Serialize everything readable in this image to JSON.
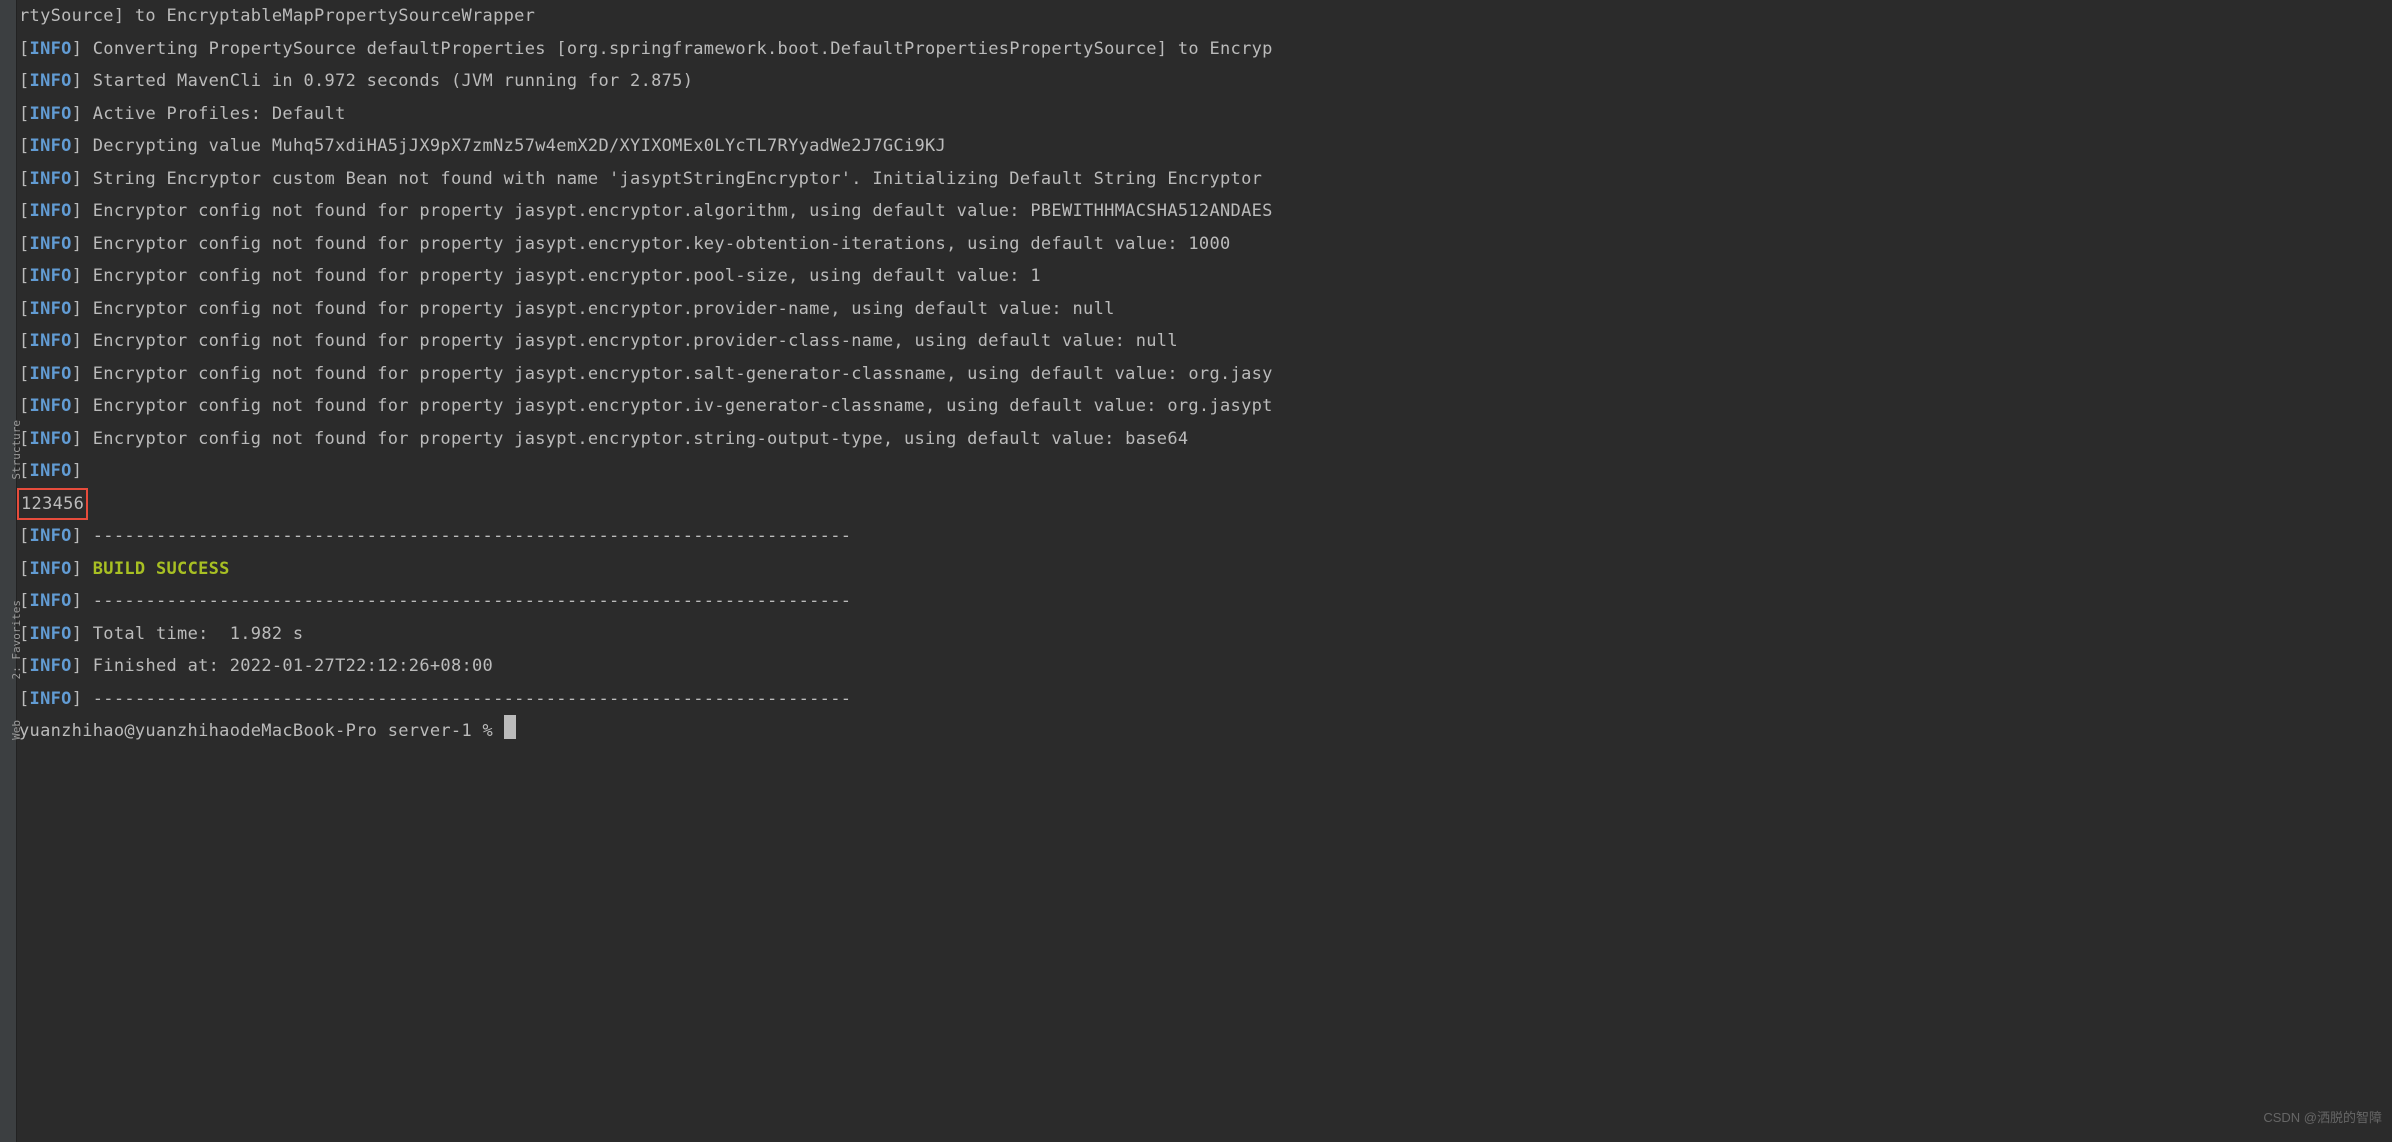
{
  "sidebar": {
    "structure": "Structure",
    "favorites": "2: Favorites",
    "web": "Web"
  },
  "lines": [
    {
      "prefix": "",
      "text": "rtySource] to EncryptableMapPropertySourceWrapper"
    },
    {
      "prefix": "INFO",
      "text": "Converting PropertySource defaultProperties [org.springframework.boot.DefaultPropertiesPropertySource] to Encryp"
    },
    {
      "prefix": "INFO",
      "text": "Started MavenCli in 0.972 seconds (JVM running for 2.875)"
    },
    {
      "prefix": "INFO",
      "text": "Active Profiles: Default"
    },
    {
      "prefix": "INFO",
      "text": "Decrypting value Muhq57xdiHA5jJX9pX7zmNz57w4emX2D/XYIXOMEx0LYcTL7RYyadWe2J7GCi9KJ"
    },
    {
      "prefix": "INFO",
      "text": "String Encryptor custom Bean not found with name 'jasyptStringEncryptor'. Initializing Default String Encryptor"
    },
    {
      "prefix": "INFO",
      "text": "Encryptor config not found for property jasypt.encryptor.algorithm, using default value: PBEWITHHMACSHA512ANDAES"
    },
    {
      "prefix": "INFO",
      "text": "Encryptor config not found for property jasypt.encryptor.key-obtention-iterations, using default value: 1000"
    },
    {
      "prefix": "INFO",
      "text": "Encryptor config not found for property jasypt.encryptor.pool-size, using default value: 1"
    },
    {
      "prefix": "INFO",
      "text": "Encryptor config not found for property jasypt.encryptor.provider-name, using default value: null"
    },
    {
      "prefix": "INFO",
      "text": "Encryptor config not found for property jasypt.encryptor.provider-class-name, using default value: null"
    },
    {
      "prefix": "INFO",
      "text": "Encryptor config not found for property jasypt.encryptor.salt-generator-classname, using default value: org.jasy"
    },
    {
      "prefix": "INFO",
      "text": "Encryptor config not found for property jasypt.encryptor.iv-generator-classname, using default value: org.jasypt"
    },
    {
      "prefix": "INFO",
      "text": "Encryptor config not found for property jasypt.encryptor.string-output-type, using default value: base64"
    },
    {
      "prefix": "INFO",
      "text": ""
    },
    {
      "highlighted": "123456"
    },
    {
      "prefix": "INFO",
      "text": "------------------------------------------------------------------------"
    },
    {
      "prefix": "INFO",
      "buildSuccess": "BUILD SUCCESS"
    },
    {
      "prefix": "INFO",
      "text": "------------------------------------------------------------------------"
    },
    {
      "prefix": "INFO",
      "text": "Total time:  1.982 s"
    },
    {
      "prefix": "INFO",
      "text": "Finished at: 2022-01-27T22:12:26+08:00"
    },
    {
      "prefix": "INFO",
      "text": "------------------------------------------------------------------------"
    }
  ],
  "prompt": "yuanzhihao@yuanzhihaodeMacBook-Pro server-1 % ",
  "watermark": "CSDN @洒脱的智障"
}
